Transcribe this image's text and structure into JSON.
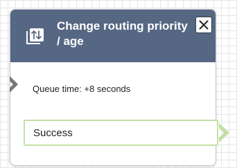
{
  "block": {
    "title": "Change routing priority / age",
    "icon": "swap-vertical-icon",
    "close_icon": "close-icon",
    "description": "Queue time: +8 seconds",
    "branches": [
      {
        "label": "Success",
        "color": "#c2e0a6"
      }
    ],
    "colors": {
      "header": "#566783",
      "port_in": "#777777",
      "port_out": "#c2e0a6"
    }
  }
}
